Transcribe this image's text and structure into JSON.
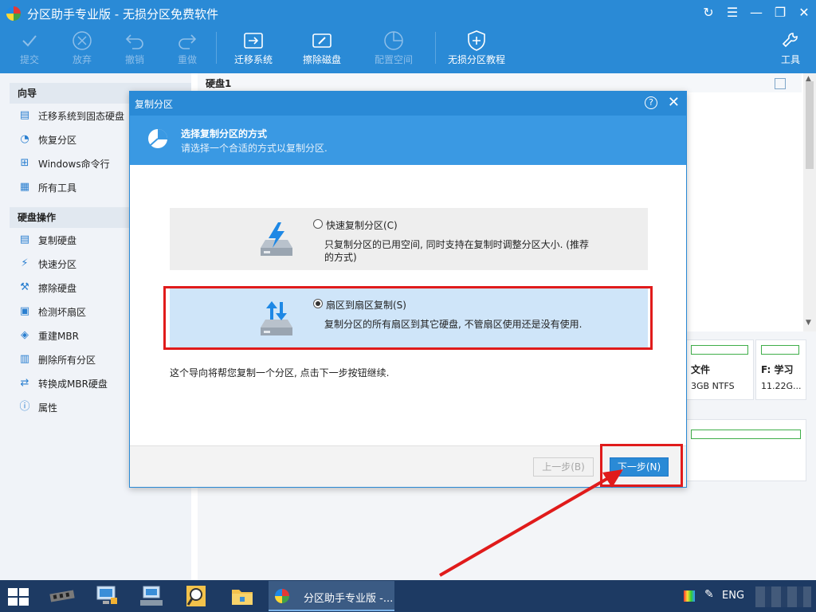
{
  "window": {
    "title": "分区助手专业版 - 无损分区免费软件"
  },
  "toolbar": {
    "buttons": [
      {
        "label": "提交",
        "icon": "check-icon",
        "enabled": false
      },
      {
        "label": "放弃",
        "icon": "cancel-circle-icon",
        "enabled": false
      },
      {
        "label": "撤销",
        "icon": "undo-icon",
        "enabled": false
      },
      {
        "label": "重做",
        "icon": "redo-icon",
        "enabled": false
      },
      {
        "label": "迁移系统",
        "icon": "migrate-os-icon",
        "enabled": true
      },
      {
        "label": "擦除磁盘",
        "icon": "wipe-disk-icon",
        "enabled": true
      },
      {
        "label": "配置空间",
        "icon": "allocate-space-icon",
        "enabled": false
      },
      {
        "label": "无损分区教程",
        "icon": "shield-plus-icon",
        "enabled": true
      }
    ],
    "tools_label": "工具"
  },
  "sidebar": {
    "wizard_heading": "向导",
    "wizard_items": [
      {
        "label": "迁移系统到固态硬盘",
        "icon": "migrate-ssd-icon"
      },
      {
        "label": "恢复分区",
        "icon": "recover-partition-icon"
      },
      {
        "label": "Windows命令行",
        "icon": "windows-logo-icon"
      },
      {
        "label": "所有工具",
        "icon": "grid-tools-icon"
      }
    ],
    "disk_heading": "硬盘操作",
    "disk_items": [
      {
        "label": "复制硬盘",
        "icon": "copy-disk-icon"
      },
      {
        "label": "快速分区",
        "icon": "lightning-icon"
      },
      {
        "label": "擦除硬盘",
        "icon": "broom-icon"
      },
      {
        "label": "检测坏扇区",
        "icon": "scan-disk-icon"
      },
      {
        "label": "重建MBR",
        "icon": "tag-icon"
      },
      {
        "label": "删除所有分区",
        "icon": "delete-partitions-icon"
      },
      {
        "label": "转换成MBR硬盘",
        "icon": "convert-icon"
      },
      {
        "label": "属性",
        "icon": "info-icon"
      }
    ]
  },
  "main": {
    "disk_label": "硬盘1",
    "partitions": [
      {
        "name": "文件",
        "size": "3GB NTFS"
      },
      {
        "name": "F: 学习",
        "size": "11.22G..."
      }
    ]
  },
  "dialog": {
    "title": "复制分区",
    "heading": "选择复制分区的方式",
    "subheading": "请选择一个合适的方式以复制分区.",
    "options": [
      {
        "label": "快速复制分区(C)",
        "description": "只复制分区的已用空间, 同时支持在复制时调整分区大小. (推荐的方式)",
        "selected": false
      },
      {
        "label": "扇区到扇区复制(S)",
        "description": "复制分区的所有扇区到其它硬盘, 不管扇区使用还是没有使用.",
        "selected": true
      }
    ],
    "info": "这个导向将帮您复制一个分区, 点击下一步按钮继续.",
    "prev_label": "上一步(B)",
    "next_label": "下一步(N)"
  },
  "taskbar": {
    "active_app_label": "分区助手专业版 -...",
    "language": "ENG"
  },
  "colors": {
    "accent": "#2a8ad6",
    "dialog_header": "#3a99e3",
    "selected_option": "#cfe5f9",
    "highlight_red": "#e01b1b",
    "taskbar": "#1d3a63"
  }
}
